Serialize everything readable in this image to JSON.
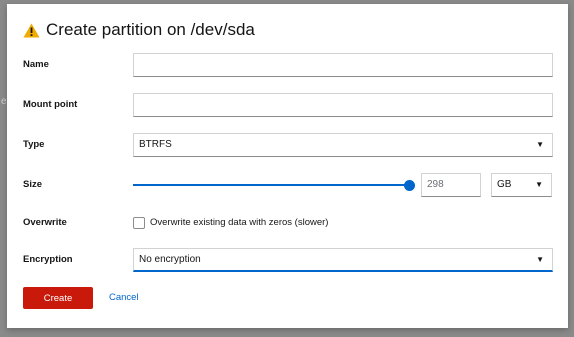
{
  "backdrop": {
    "fragment": "e"
  },
  "dialog": {
    "title": "Create partition on /dev/sda",
    "icon": "warning-icon",
    "accent": "#f0ab00"
  },
  "fields": {
    "name": {
      "label": "Name",
      "value": "",
      "placeholder": ""
    },
    "mount_point": {
      "label": "Mount point",
      "value": "",
      "placeholder": ""
    },
    "type": {
      "label": "Type",
      "selected": "BTRFS"
    },
    "size": {
      "label": "Size",
      "value": "298",
      "unit": "GB",
      "slider_level": 1.0
    },
    "overwrite": {
      "label": "Overwrite",
      "checkbox_label": "Overwrite existing data with zeros (slower)",
      "checked": false
    },
    "encryption": {
      "label": "Encryption",
      "selected": "No encryption"
    }
  },
  "actions": {
    "create_label": "Create",
    "cancel_label": "Cancel"
  },
  "colors": {
    "primary_danger": "#c9190b",
    "link": "#0066cc"
  }
}
